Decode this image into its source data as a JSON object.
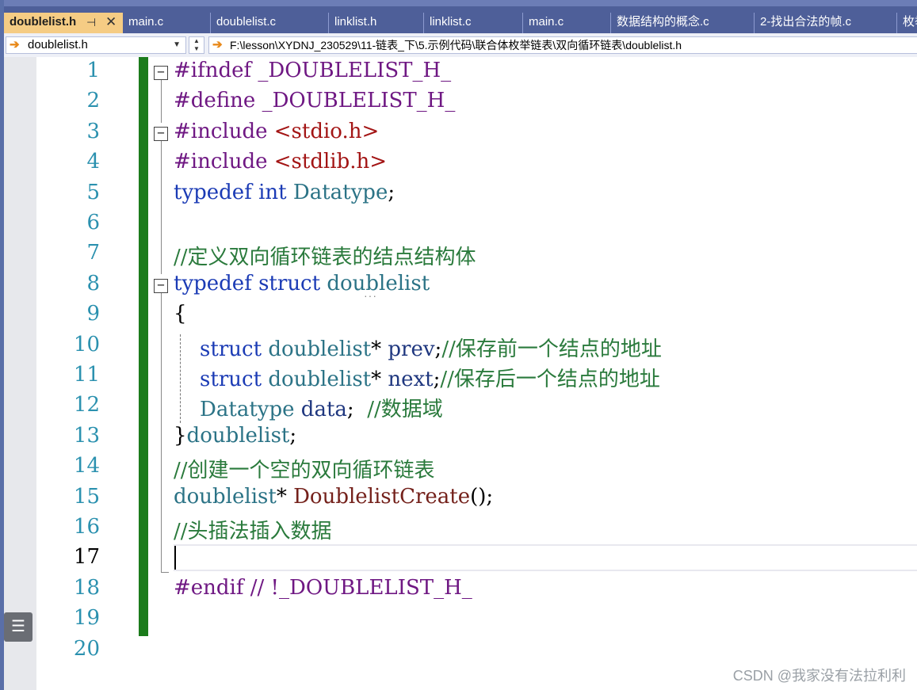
{
  "tabs": [
    {
      "label": "doublelist.h",
      "active": true
    },
    {
      "label": "main.c"
    },
    {
      "label": "doublelist.c"
    },
    {
      "label": "linklist.h"
    },
    {
      "label": "linklist.c"
    },
    {
      "label": "main.c"
    },
    {
      "label": "数据结构的概念.c"
    },
    {
      "label": "2-找出合法的帧.c"
    },
    {
      "label": "枚举"
    }
  ],
  "tab_pin_icon": "pin-icon",
  "tab_close_symbol": "✕",
  "nav": {
    "scope_value": "doublelist.h",
    "path_value": "F:\\lesson\\XYDNJ_230529\\11-链表_下\\5.示例代码\\联合体枚举链表\\双向循环链表\\doublelist.h"
  },
  "editor": {
    "line_numbers": [
      "1",
      "2",
      "3",
      "4",
      "5",
      "6",
      "7",
      "8",
      "9",
      "10",
      "11",
      "12",
      "13",
      "14",
      "15",
      "16",
      "17",
      "18",
      "19",
      "20"
    ],
    "current_line": "17",
    "lines": [
      {
        "n": 1,
        "parts": [
          {
            "t": "#ifndef ",
            "c": "mac"
          },
          {
            "t": "_DOUBLELIST_H_",
            "c": "mac"
          }
        ]
      },
      {
        "n": 2,
        "parts": [
          {
            "t": "#define ",
            "c": "mac"
          },
          {
            "t": "_DOUBLELIST_H_",
            "c": "mac"
          }
        ]
      },
      {
        "n": 3,
        "parts": [
          {
            "t": "#include ",
            "c": "mac"
          },
          {
            "t": "<stdio.h>",
            "c": "str"
          }
        ]
      },
      {
        "n": 4,
        "parts": [
          {
            "t": "#include ",
            "c": "mac"
          },
          {
            "t": "<stdlib.h>",
            "c": "str"
          }
        ]
      },
      {
        "n": 5,
        "parts": [
          {
            "t": "typedef ",
            "c": "kw"
          },
          {
            "t": "int ",
            "c": "kw"
          },
          {
            "t": "Datatype",
            "c": "typ"
          },
          {
            "t": ";",
            "c": ""
          }
        ]
      },
      {
        "n": 6,
        "parts": []
      },
      {
        "n": 7,
        "parts": [
          {
            "t": "//定义双向循环链表的结点结构体",
            "c": "cmt"
          }
        ]
      },
      {
        "n": 8,
        "parts": [
          {
            "t": "typedef ",
            "c": "kw"
          },
          {
            "t": "struct ",
            "c": "kw"
          },
          {
            "t": "doublelist",
            "c": "typ"
          }
        ]
      },
      {
        "n": 9,
        "parts": [
          {
            "t": "{",
            "c": ""
          }
        ]
      },
      {
        "n": 10,
        "parts": [
          {
            "t": "    struct ",
            "c": "kw"
          },
          {
            "t": "doublelist",
            "c": "typ"
          },
          {
            "t": "* ",
            "c": ""
          },
          {
            "t": "prev",
            "c": "id"
          },
          {
            "t": ";",
            "c": ""
          },
          {
            "t": "//保存前一个结点的地址",
            "c": "cmt"
          }
        ]
      },
      {
        "n": 11,
        "parts": [
          {
            "t": "    struct ",
            "c": "kw"
          },
          {
            "t": "doublelist",
            "c": "typ"
          },
          {
            "t": "* ",
            "c": ""
          },
          {
            "t": "next",
            "c": "id"
          },
          {
            "t": ";",
            "c": ""
          },
          {
            "t": "//保存后一个结点的地址",
            "c": "cmt"
          }
        ]
      },
      {
        "n": 12,
        "parts": [
          {
            "t": "    Datatype ",
            "c": "typ"
          },
          {
            "t": "data",
            "c": "id"
          },
          {
            "t": ";  ",
            "c": ""
          },
          {
            "t": "//数据域",
            "c": "cmt"
          }
        ]
      },
      {
        "n": 13,
        "parts": [
          {
            "t": "}",
            "c": ""
          },
          {
            "t": "doublelist",
            "c": "typ"
          },
          {
            "t": ";",
            "c": ""
          }
        ]
      },
      {
        "n": 14,
        "parts": [
          {
            "t": "//创建一个空的双向循环链表",
            "c": "cmt"
          }
        ]
      },
      {
        "n": 15,
        "parts": [
          {
            "t": "doublelist",
            "c": "typ"
          },
          {
            "t": "* ",
            "c": ""
          },
          {
            "t": "DoublelistCreate",
            "c": "fn"
          },
          {
            "t": "();",
            "c": ""
          }
        ]
      },
      {
        "n": 16,
        "parts": [
          {
            "t": "//头插法插入数据",
            "c": "cmt"
          }
        ]
      },
      {
        "n": 17,
        "parts": []
      },
      {
        "n": 18,
        "parts": [
          {
            "t": "#endif ",
            "c": "mac"
          },
          {
            "t": "// !_DOUBLELIST_H_",
            "c": "mac"
          }
        ]
      },
      {
        "n": 19,
        "parts": []
      },
      {
        "n": 20,
        "parts": []
      }
    ]
  },
  "icons": {
    "nav_arrow": "arrow-right-icon",
    "fold": "collapse-icon",
    "side_button": "list-icon"
  },
  "watermark": "CSDN @我家没有法拉利利",
  "colors": {
    "tab_active": "#f5cc84",
    "tab_bar": "#4e5f99",
    "margin_bar": "#1b7b1b",
    "keyword": "#1b3bb5",
    "macro": "#6f1883",
    "string": "#a31515",
    "type": "#2b7386",
    "comment": "#2a7a3c",
    "line_number": "#2b91af"
  }
}
